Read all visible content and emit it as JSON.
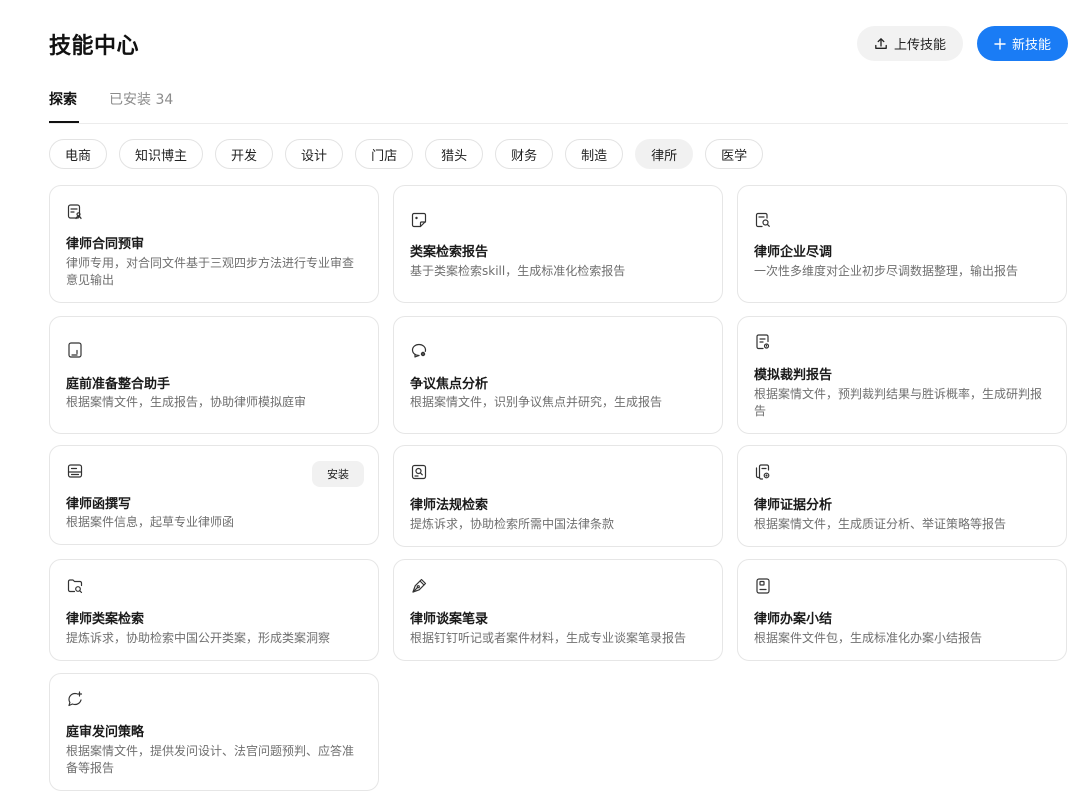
{
  "header": {
    "title": "技能中心",
    "upload_label": "上传技能",
    "new_label": "新技能"
  },
  "tabs": [
    {
      "label": "探索"
    },
    {
      "label": "已安装 34"
    }
  ],
  "categories": [
    "电商",
    "知识博主",
    "开发",
    "设计",
    "门店",
    "猎头",
    "财务",
    "制造",
    "律所",
    "医学"
  ],
  "selected_category": "律所",
  "skills": [
    {
      "title": "律师合同预审",
      "desc": "律师专用，对合同文件基于三观四步方法进行专业审查意见输出",
      "icon": "document-person-icon"
    },
    {
      "title": "类案检索报告",
      "desc": "基于类案检索skill，生成标准化检索报告",
      "icon": "note-icon"
    },
    {
      "title": "律师企业尽调",
      "desc": "一次性多维度对企业初步尽调数据整理，输出报告",
      "icon": "document-search-icon"
    },
    {
      "title": "庭前准备整合助手",
      "desc": "根据案情文件，生成报告，协助律师模拟庭审",
      "icon": "file-icon"
    },
    {
      "title": "争议焦点分析",
      "desc": "根据案情文件，识别争议焦点并研究，生成报告",
      "icon": "chat-settings-icon"
    },
    {
      "title": "模拟裁判报告",
      "desc": "根据案情文件，预判裁判结果与胜诉概率，生成研判报告",
      "icon": "document-lock-icon"
    },
    {
      "title": "律师函撰写",
      "desc": "根据案件信息，起草专业律师函",
      "icon": "letter-icon",
      "install_label": "安装"
    },
    {
      "title": "律师法规检索",
      "desc": "提炼诉求，协助检索所需中国法律条款",
      "icon": "image-search-icon"
    },
    {
      "title": "律师证据分析",
      "desc": "根据案情文件，生成质证分析、举证策略等报告",
      "icon": "documents-settings-icon"
    },
    {
      "title": "律师类案检索",
      "desc": "提炼诉求，协助检索中国公开类案，形成类案洞察",
      "icon": "folder-search-icon"
    },
    {
      "title": "律师谈案笔录",
      "desc": "根据钉钉听记或者案件材料，生成专业谈案笔录报告",
      "icon": "pen-icon"
    },
    {
      "title": "律师办案小结",
      "desc": "根据案件文件包，生成标准化办案小结报告",
      "icon": "notebook-icon"
    },
    {
      "title": "庭审发问策略",
      "desc": "根据案情文件，提供发问设计、法官问题预判、应答准备等报告",
      "icon": "chat-sparkle-icon"
    }
  ],
  "colors": {
    "accent": "#1a7cf5",
    "card_border": "#e6e6e6",
    "muted_text": "#6f6f6f"
  }
}
